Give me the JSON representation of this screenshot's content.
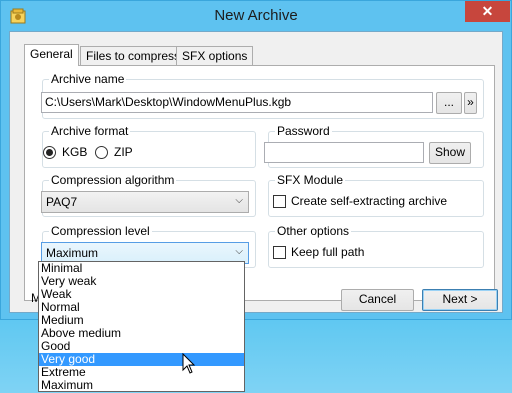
{
  "window": {
    "title": "New Archive",
    "close_glyph": "✕"
  },
  "tabs": [
    {
      "label": "General",
      "active": true
    },
    {
      "label": "Files to compress",
      "active": false
    },
    {
      "label": "SFX options",
      "active": false
    }
  ],
  "archive_name": {
    "legend": "Archive name",
    "value": "C:\\Users\\Mark\\Desktop\\WindowMenuPlus.kgb",
    "browse_label": "...",
    "expand_label": "»"
  },
  "archive_format": {
    "legend": "Archive format",
    "options": [
      {
        "label": "KGB",
        "checked": true
      },
      {
        "label": "ZIP",
        "checked": false
      }
    ]
  },
  "password": {
    "legend": "Password",
    "value": "",
    "show_label": "Show"
  },
  "compression_algorithm": {
    "legend": "Compression algorithm",
    "selected": "PAQ7"
  },
  "sfx_module": {
    "legend": "SFX Module",
    "checkbox_label": "Create self-extracting archive",
    "checked": false
  },
  "compression_level": {
    "legend": "Compression level",
    "selected": "Maximum",
    "options": [
      "Minimal",
      "Very weak",
      "Weak",
      "Normal",
      "Medium",
      "Above medium",
      "Good",
      "Very good",
      "Extreme",
      "Maximum"
    ],
    "highlighted": "Very good"
  },
  "other_options": {
    "legend": "Other options",
    "checkbox_label": "Keep full path",
    "checked": false
  },
  "footer": {
    "partial_label": "M",
    "cancel_label": "Cancel",
    "next_label": "Next >"
  },
  "colors": {
    "accent": "#3399ff",
    "close": "#c7463d",
    "titlebar": "#5ec2f0"
  }
}
